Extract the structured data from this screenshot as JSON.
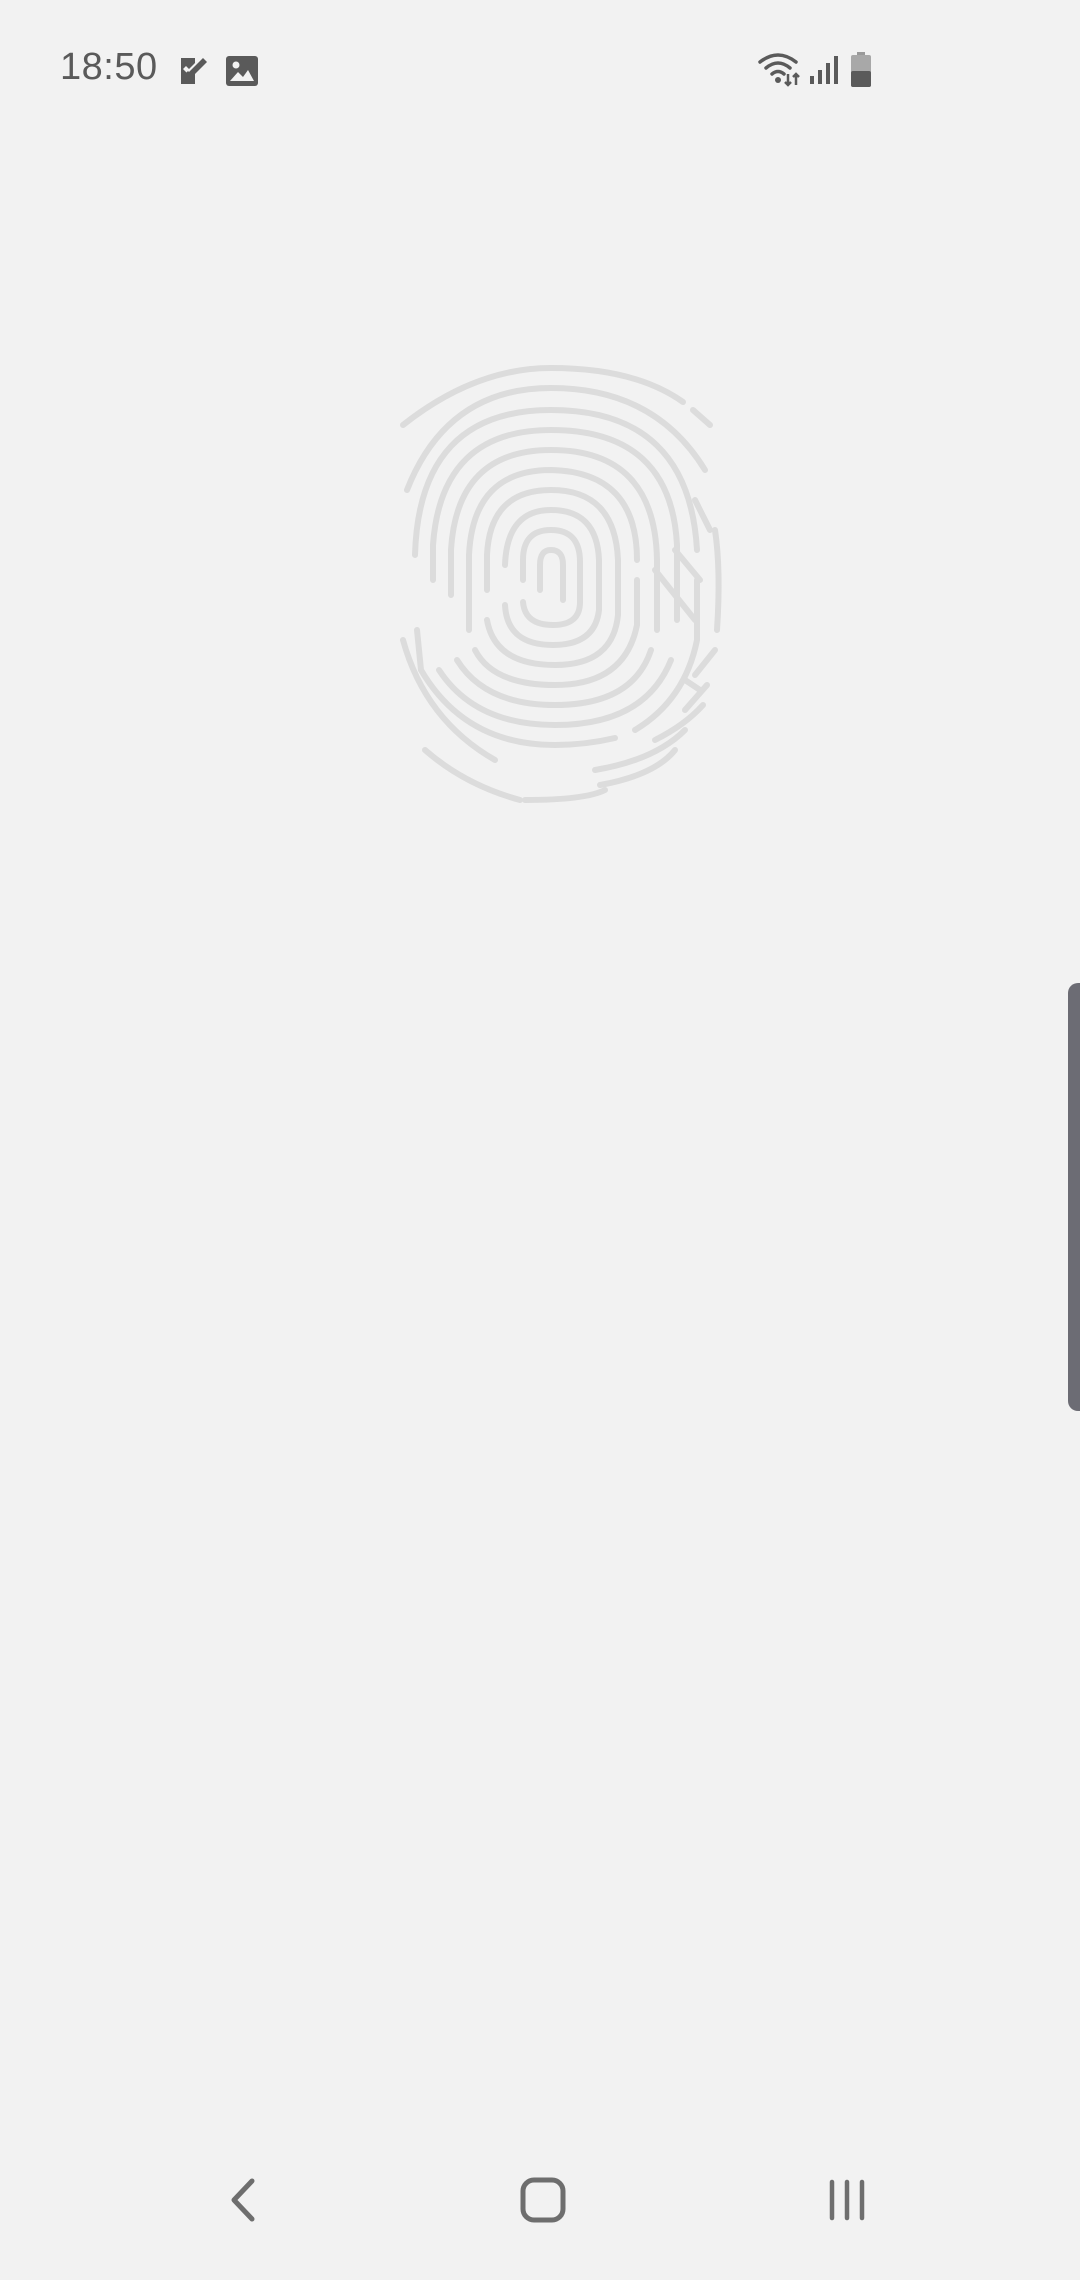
{
  "status_bar": {
    "time": "18:50",
    "notification_icons": [
      "task-check-icon",
      "image-gallery-icon"
    ],
    "system_icons": [
      "wifi-icon",
      "cellular-signal-icon",
      "battery-icon"
    ]
  },
  "main": {
    "fingerprint_icon": "fingerprint-icon"
  },
  "edge_panel": {
    "handle": "edge-panel-handle"
  },
  "nav_bar": {
    "buttons": [
      "back-icon",
      "home-icon",
      "recents-icon"
    ]
  },
  "colors": {
    "background": "#f2f2f2",
    "status_icons": "#5a5a5a",
    "fingerprint": "#dcdcdc",
    "edge_handle": "#6c6c74",
    "nav_icons": "#6e6e6e"
  }
}
